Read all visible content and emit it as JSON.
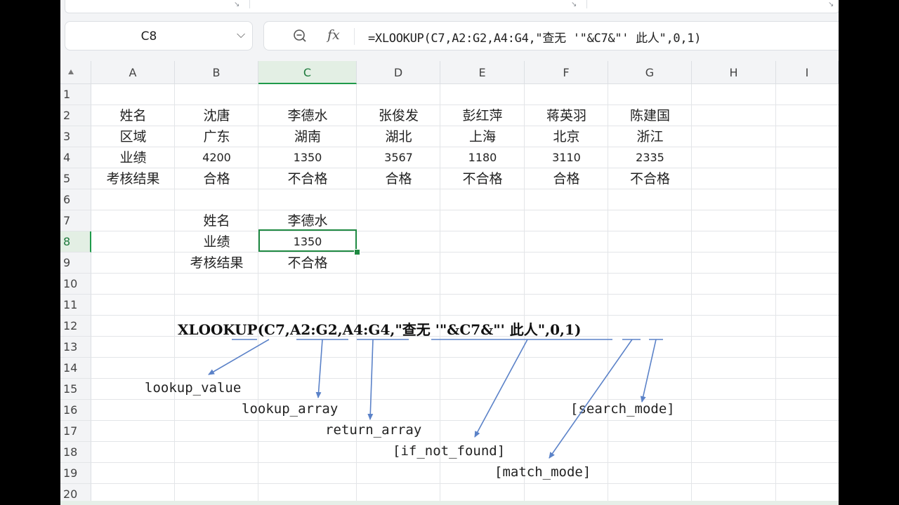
{
  "name_box": {
    "value": "C8"
  },
  "formula_bar": {
    "formula": "=XLOOKUP(C7,A2:G2,A4:G4,\"查无 '\"&C7&\"' 此人\",0,1)"
  },
  "columns": [
    "A",
    "B",
    "C",
    "D",
    "E",
    "F",
    "G",
    "H",
    "I"
  ],
  "rows": [
    "1",
    "2",
    "3",
    "4",
    "5",
    "6",
    "7",
    "8",
    "9",
    "10",
    "11",
    "12",
    "13",
    "14",
    "15",
    "16",
    "17",
    "18",
    "19",
    "20"
  ],
  "active_cell": {
    "column": "C",
    "row": "8"
  },
  "table": {
    "row2": [
      "姓名",
      "沈唐",
      "李德水",
      "张俊发",
      "彭红萍",
      "蒋英羽",
      "陈建国"
    ],
    "row3": [
      "区域",
      "广东",
      "湖南",
      "湖北",
      "上海",
      "北京",
      "浙江"
    ],
    "row4": [
      "业绩",
      "4200",
      "1350",
      "3567",
      "1180",
      "3110",
      "2335"
    ],
    "row5": [
      "考核结果",
      "合格",
      "不合格",
      "合格",
      "不合格",
      "合格",
      "不合格"
    ]
  },
  "lookup": {
    "row7": [
      "姓名",
      "李德水"
    ],
    "row8": [
      "业绩",
      "1350"
    ],
    "row9": [
      "考核结果",
      "不合格"
    ]
  },
  "annotation": {
    "formula": "XLOOKUP(C7,A2:G2,A4:G4,\"查无 '\"&C7&\"' 此人\",0,1)",
    "labels": {
      "lookup_value": "lookup_value",
      "lookup_array": "lookup_array",
      "return_array": "return_array",
      "if_not_found": "[if_not_found]",
      "match_mode": "[match_mode]",
      "search_mode": "[search_mode]"
    },
    "arrow_color": "#5b82c8"
  },
  "colors": {
    "selection": "#1f8a42",
    "header_active_bg": "#e3efe4"
  }
}
